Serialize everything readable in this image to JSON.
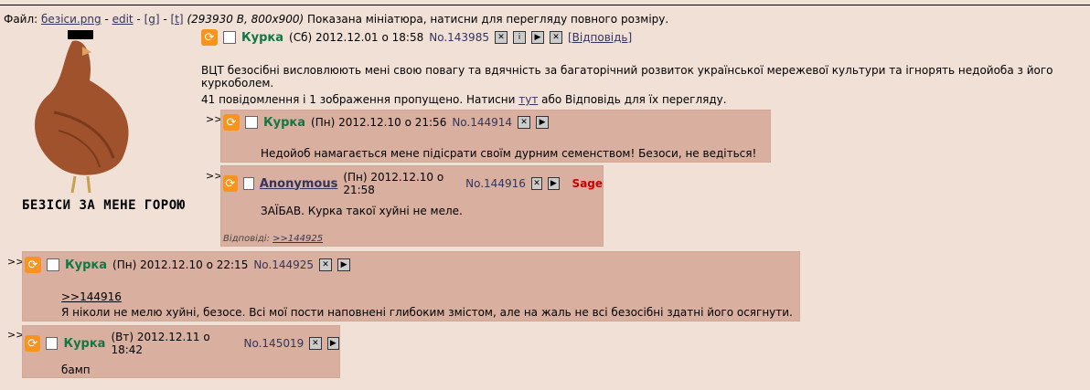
{
  "file": {
    "label": "Файл:",
    "name": "безіси.png",
    "edit": "edit",
    "g": "[g]",
    "t": "[t]",
    "meta": "(293930 B, 800x900)",
    "note": "Показана мініатюра, натисни для перегляду повного розміру."
  },
  "thumb": {
    "caption": "БЕЗІСИ ЗА МЕНЕ ГОРОЮ"
  },
  "op": {
    "name": "Курка",
    "date": "(Сб) 2012.12.01 о 18:58",
    "no": "No.143985",
    "reply": "[Відповідь]",
    "text": "ВЦТ безосібні висловлюють мені свою повагу та вдячність за багаторічний розвиток української мережевої культури та ігнорять недойоба з його куркоболем.",
    "omitted_a": "41 повідомлення і 1 зображення пропущено. Натисни ",
    "omitted_link": "тут",
    "omitted_b": " або Відповідь для їх перегляду."
  },
  "arrows": ">>",
  "replies": [
    {
      "name": "Курка",
      "date": "(Пн) 2012.12.10 о 21:56",
      "no": "No.144914",
      "text": "Недойоб намагається мене підісрати своїм дурним семенством! Безоси, не ведіться!"
    },
    {
      "name": "Anonymous",
      "date": "(Пн) 2012.12.10 о 21:58",
      "no": "No.144916",
      "sage": "Sage",
      "text": "ЗАЇБАВ. Курка такої хуйні не меле.",
      "backlinks_label": "Відповіді:",
      "backlink": ">>144925"
    },
    {
      "name": "Курка",
      "date": "(Пн) 2012.12.10 о 22:15",
      "no": "No.144925",
      "quote": ">>144916",
      "text": "Я ніколи не мелю хуйні, безосе. Всі мої пости наповнені глибоким змістом, але на жаль не всі безосібні здатні його осягнути."
    },
    {
      "name": "Курка",
      "date": "(Вт) 2012.12.11 о 18:42",
      "no": "No.145019",
      "text": "бамп"
    }
  ]
}
